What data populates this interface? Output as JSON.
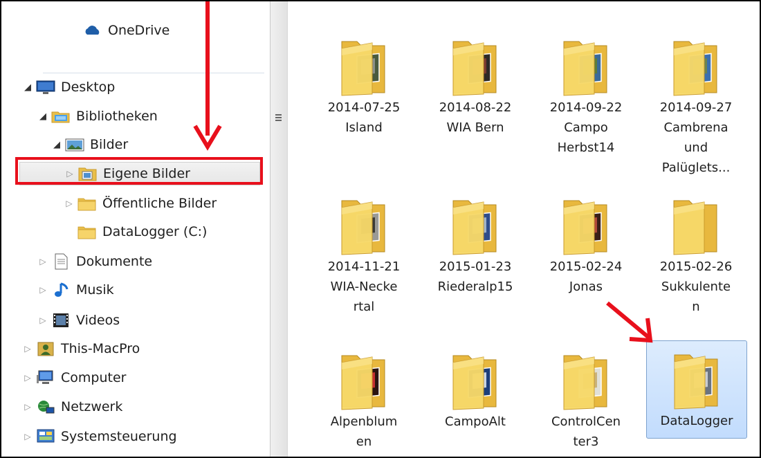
{
  "nav": {
    "items": [
      {
        "label": "OneDrive",
        "icon": "onedrive-icon",
        "expander": "none"
      },
      {
        "label": "Desktop",
        "icon": "desktop-icon",
        "expander": "expanded"
      },
      {
        "label": "Bibliotheken",
        "icon": "libraries-icon",
        "expander": "expanded"
      },
      {
        "label": "Bilder",
        "icon": "pictures-library-icon",
        "expander": "expanded"
      },
      {
        "label": "Eigene Bilder",
        "icon": "pictures-folder-icon",
        "expander": "collapsed"
      },
      {
        "label": "Öffentliche Bilder",
        "icon": "folder-icon",
        "expander": "collapsed"
      },
      {
        "label": "DataLogger (C:)",
        "icon": "folder-icon",
        "expander": "none"
      },
      {
        "label": "Dokumente",
        "icon": "documents-icon",
        "expander": "collapsed"
      },
      {
        "label": "Musik",
        "icon": "music-icon",
        "expander": "collapsed"
      },
      {
        "label": "Videos",
        "icon": "videos-icon",
        "expander": "collapsed"
      },
      {
        "label": "This-MacPro",
        "icon": "user-icon",
        "expander": "collapsed"
      },
      {
        "label": "Computer",
        "icon": "computer-icon",
        "expander": "collapsed"
      },
      {
        "label": "Netzwerk",
        "icon": "network-icon",
        "expander": "collapsed"
      },
      {
        "label": "Systemsteuerung",
        "icon": "control-panel-icon",
        "expander": "collapsed"
      }
    ],
    "highlighted": "Eigene Bilder"
  },
  "folders": [
    {
      "lines": [
        "2014-07-25",
        "Island"
      ],
      "thumb": [
        "#4a5a3e",
        "#8a8f88"
      ]
    },
    {
      "lines": [
        "2014-08-22",
        "WIA Bern"
      ],
      "thumb": [
        "#2d2a26",
        "#7a3a30"
      ]
    },
    {
      "lines": [
        "2014-09-22",
        "Campo",
        "Herbst14"
      ],
      "thumb": [
        "#3a6a9a",
        "#5d7d3a"
      ]
    },
    {
      "lines": [
        "2014-09-27",
        "Cambrena",
        "und",
        "Palüglets..."
      ],
      "thumb": [
        "#3b6fb0",
        "#6c8450"
      ]
    },
    {
      "lines": [
        "2014-11-21",
        "WIA-Necke",
        "rtal"
      ],
      "thumb": [
        "#9a9a96",
        "#3a3a36"
      ]
    },
    {
      "lines": [
        "2015-01-23",
        "Riederalp15"
      ],
      "thumb": [
        "#2e4d8a",
        "#9fb3c8"
      ]
    },
    {
      "lines": [
        "2015-02-24",
        "Jonas"
      ],
      "thumb": [
        "#3a1f18",
        "#b04a3a"
      ]
    },
    {
      "lines": [
        "2015-02-26",
        "Sukkulente",
        "n"
      ],
      "thumb": []
    },
    {
      "lines": [
        "Alpenblum",
        "en"
      ],
      "thumb": [
        "#2b1410",
        "#c43030"
      ]
    },
    {
      "lines": [
        "CampoAlt"
      ],
      "thumb": [
        "#1d3f7a",
        "#c9d6e4"
      ]
    },
    {
      "lines": [
        "ControlCen",
        "ter3"
      ],
      "thumb": [
        "#e0e0d8",
        "#c9b27a"
      ]
    },
    {
      "lines": [
        "DataLogger"
      ],
      "thumb": [
        "#6a7380",
        "#c8cdd3"
      ],
      "selected": true
    }
  ],
  "colors": {
    "accent_red": "#e8101c",
    "selection": "#cde4fc",
    "folder_yellow": "#f2cf5b"
  }
}
